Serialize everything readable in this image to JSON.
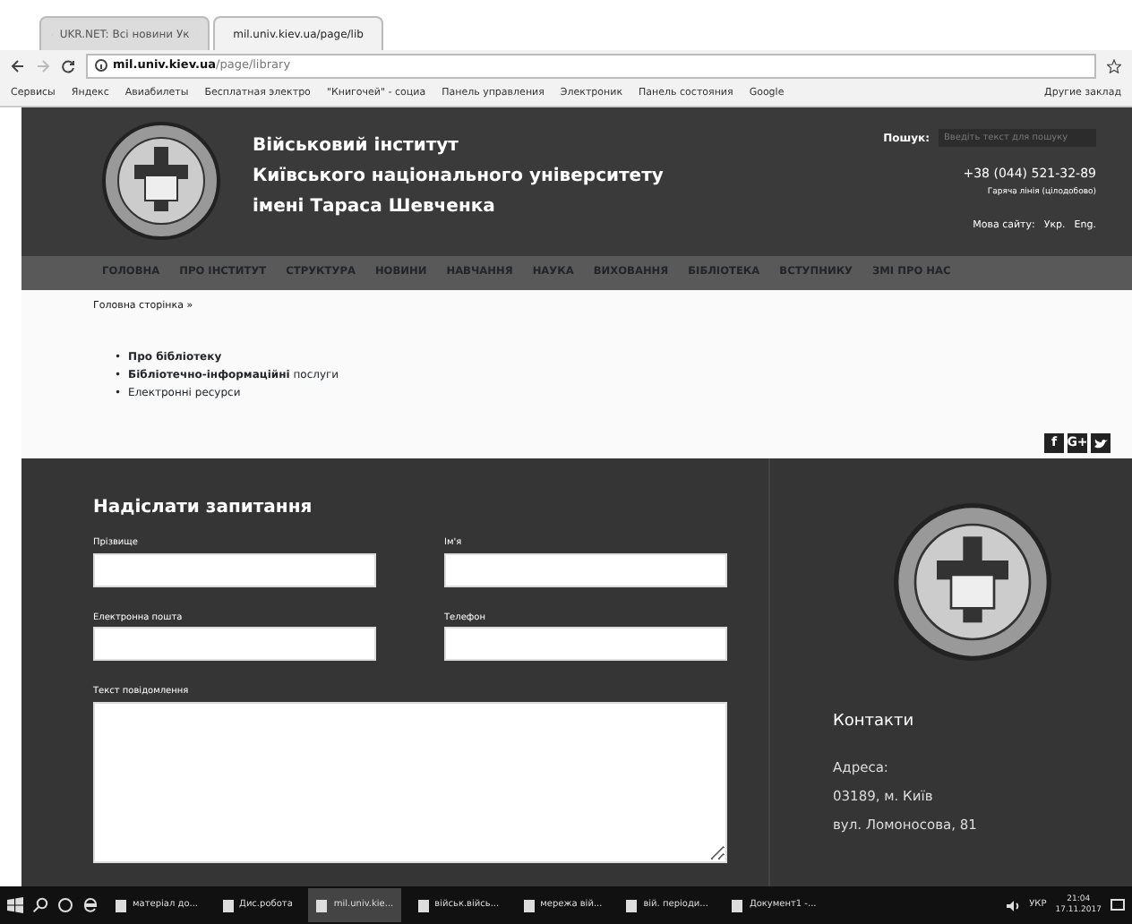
{
  "browser": {
    "tabs": [
      {
        "title": "UKR.NET: Всі новини Ук",
        "selected": false
      },
      {
        "title": "mil.univ.kiev.ua/page/lib",
        "selected": true
      }
    ],
    "address": {
      "host": "mil.univ.kiev.ua",
      "path": "/page/library"
    },
    "bookmarks": [
      "Сервисы",
      "Яндекс",
      "Авиабилеты",
      "Бесплатная электро",
      "\"Книгочей\" - социа",
      "Панель управления",
      "Электроник",
      "Панель состояния",
      "Google"
    ],
    "other_bookmarks": "Другие заклад"
  },
  "header": {
    "title_lines": [
      "Військовий інститут",
      "Київського національного університету",
      "імені Тараса Шевченка"
    ],
    "search": {
      "label": "Пошук:",
      "placeholder": "Введіть текст для пошуку"
    },
    "phone": "+38 (044) 521-32-89",
    "phone_note": "Гаряча лінія (цілодобово)",
    "language": {
      "label": "Мова сайту:",
      "options": [
        "Укр.",
        "Eng."
      ]
    }
  },
  "nav": [
    "ГОЛОВНА",
    "ПРО ІНСТИТУТ",
    "СТРУКТУРА",
    "НОВИНИ",
    "НАВЧАННЯ",
    "НАУКА",
    "ВИХОВАННЯ",
    "БІБЛІОТЕКА",
    "ВСТУПНИКУ",
    "ЗМІ ПРО НАС"
  ],
  "breadcrumb": "Головна сторінка »",
  "links": [
    {
      "bullet": "•",
      "text": "**Про бібліотеку**"
    },
    {
      "bullet": "•",
      "text": "**Бібліотечно-інформаційні** послуги"
    },
    {
      "bullet": "•",
      "text": "Електронні ресурси"
    }
  ],
  "social": [
    "f",
    "G+"
  ],
  "form": {
    "title": "Надіслати запитання",
    "fields": [
      {
        "label": "Прізвище",
        "kind": "input"
      },
      {
        "label": "Ім'я",
        "kind": "input"
      },
      {
        "label": "Електронна пошта",
        "kind": "input"
      },
      {
        "label": "Телефон",
        "kind": "input"
      },
      {
        "label": "Текст повідомлення",
        "kind": "textarea"
      }
    ]
  },
  "contacts": {
    "title": "Контакти",
    "lines": [
      "Адреса:",
      "03189, м. Київ",
      "вул. Ломоносова, 81"
    ]
  },
  "taskbar": {
    "apps": [
      {
        "label": "матеріал до...",
        "active": false
      },
      {
        "label": "Дис.робота",
        "active": false
      },
      {
        "label": "mil.univ.kie...",
        "active": true
      },
      {
        "label": "військ.війсь...",
        "active": false
      },
      {
        "label": "мережа вій...",
        "active": false
      },
      {
        "label": "вій. періоди...",
        "active": false
      },
      {
        "label": "Документ1 -...",
        "active": false
      }
    ],
    "language": "УКР",
    "time": "21:04",
    "date": "17.11.2017"
  }
}
